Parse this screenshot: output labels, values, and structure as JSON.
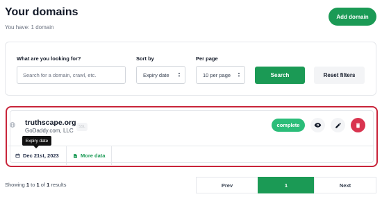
{
  "header": {
    "title": "Your domains",
    "subtitle": "You have: 1 domain",
    "add_button": "Add domain"
  },
  "filters": {
    "search_label": "What are you looking for?",
    "search_placeholder": "Search for a domain, crawl, etc.",
    "sort_label": "Sort by",
    "sort_value": "Expiry date",
    "per_page_label": "Per page",
    "per_page_value": "10 per page",
    "search_button": "Search",
    "reset_button": "Reset filters"
  },
  "domain": {
    "name": "truthscape.org",
    "registrar": "GoDaddy.com, LLC",
    "ssl_badge": "SSL",
    "status": "complete",
    "expiry_tooltip": "Expiry date",
    "expiry_date": "Dec 21st, 2023",
    "more_data": "More data",
    "icons": [
      "globe-icon",
      "eye-icon",
      "pencil-icon",
      "trash-icon",
      "calendar-icon",
      "document-icon"
    ]
  },
  "pagination": {
    "results_prefix": "Showing",
    "from": "1",
    "to_word": "to",
    "to": "1",
    "of_word": "of",
    "total": "1",
    "results_suffix": "results",
    "prev": "Prev",
    "current": "1",
    "next": "Next"
  },
  "colors": {
    "accent": "#1b9a55",
    "status_complete": "#2bbd79",
    "delete": "#d9344f",
    "highlight_border": "#c8243a"
  }
}
